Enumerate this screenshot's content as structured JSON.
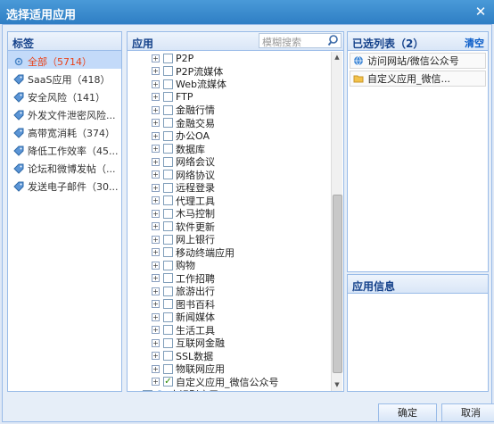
{
  "dialog": {
    "title": "选择适用应用",
    "close": "✕"
  },
  "tags": {
    "header": "标签",
    "items": [
      {
        "label": "全部（5714）",
        "icon": "star-gear-icon",
        "selected": true
      },
      {
        "label": "SaaS应用（418）",
        "icon": "tag-icon"
      },
      {
        "label": "安全风险（141）",
        "icon": "tag-icon"
      },
      {
        "label": "外发文件泄密风险...",
        "icon": "tag-icon"
      },
      {
        "label": "高带宽消耗（374）",
        "icon": "tag-icon"
      },
      {
        "label": "降低工作效率（45...",
        "icon": "tag-icon"
      },
      {
        "label": "论坛和微博发帖（...",
        "icon": "tag-icon"
      },
      {
        "label": "发送电子邮件（30...",
        "icon": "tag-icon"
      }
    ]
  },
  "apps": {
    "header": "应用",
    "search_placeholder": "模糊搜索",
    "items": [
      {
        "label": "P2P",
        "checked": false
      },
      {
        "label": "P2P流媒体",
        "checked": false
      },
      {
        "label": "Web流媒体",
        "checked": false
      },
      {
        "label": "FTP",
        "checked": false
      },
      {
        "label": "金融行情",
        "checked": false
      },
      {
        "label": "金融交易",
        "checked": false
      },
      {
        "label": "办公OA",
        "checked": false
      },
      {
        "label": "数据库",
        "checked": false
      },
      {
        "label": "网络会议",
        "checked": false
      },
      {
        "label": "网络协议",
        "checked": false
      },
      {
        "label": "远程登录",
        "checked": false
      },
      {
        "label": "代理工具",
        "checked": false
      },
      {
        "label": "木马控制",
        "checked": false
      },
      {
        "label": "软件更新",
        "checked": false
      },
      {
        "label": "网上银行",
        "checked": false
      },
      {
        "label": "移动终端应用",
        "checked": false
      },
      {
        "label": "购物",
        "checked": false
      },
      {
        "label": "工作招聘",
        "checked": false
      },
      {
        "label": "旅游出行",
        "checked": false
      },
      {
        "label": "图书百科",
        "checked": false
      },
      {
        "label": "新闻媒体",
        "checked": false
      },
      {
        "label": "生活工具",
        "checked": false
      },
      {
        "label": "互联网金融",
        "checked": false
      },
      {
        "label": "SSL数据",
        "checked": false
      },
      {
        "label": "物联网应用",
        "checked": false
      },
      {
        "label": "自定义应用_微信公众号",
        "checked": true
      },
      {
        "label": "未识别应用",
        "checked": false,
        "no_expander": true,
        "icon": "unknown-app-icon"
      }
    ]
  },
  "selected": {
    "header": "已选列表（2）",
    "clear": "清空",
    "items": [
      {
        "label": "访问网站/微信公众号",
        "icon": "globe-icon"
      },
      {
        "label": "自定义应用_微信...",
        "icon": "folder-icon"
      }
    ]
  },
  "info": {
    "header": "应用信息"
  },
  "buttons": {
    "ok": "确定",
    "cancel": "取消"
  }
}
